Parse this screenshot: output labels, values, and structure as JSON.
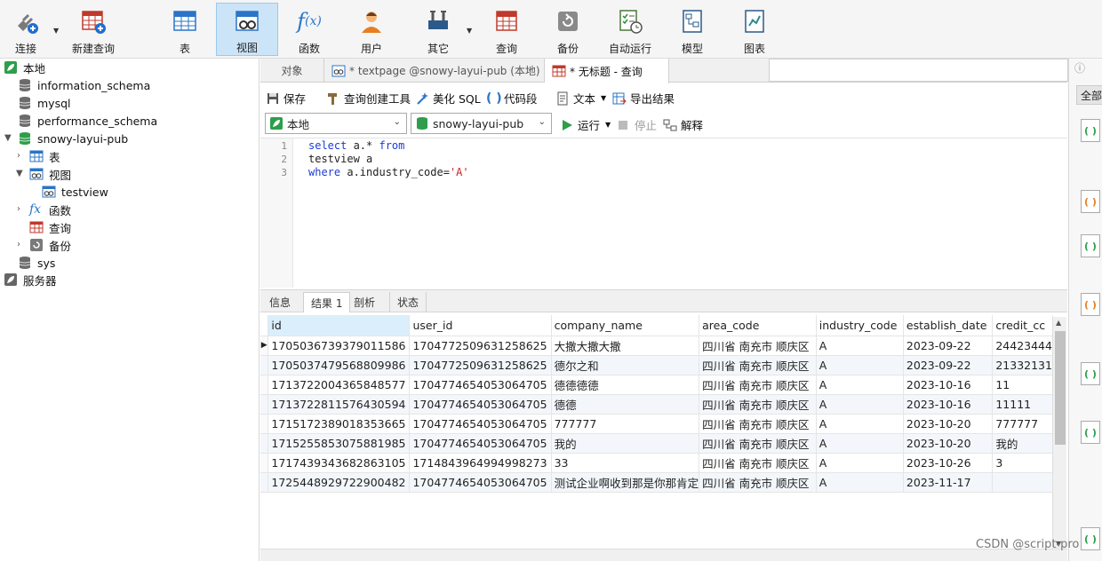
{
  "toolbar": {
    "connect": "连接",
    "new_query": "新建查询",
    "table": "表",
    "view": "视图",
    "function": "函数",
    "user": "用户",
    "other": "其它",
    "query": "查询",
    "backup": "备份",
    "auto_run": "自动运行",
    "model": "模型",
    "chart": "图表"
  },
  "sidebar": {
    "items": [
      {
        "label": "本地"
      },
      {
        "label": "information_schema"
      },
      {
        "label": "mysql"
      },
      {
        "label": "performance_schema"
      },
      {
        "label": "snowy-layui-pub"
      },
      {
        "label": "表"
      },
      {
        "label": "视图"
      },
      {
        "label": "testview"
      },
      {
        "label": "函数"
      },
      {
        "label": "查询"
      },
      {
        "label": "备份"
      },
      {
        "label": "sys"
      },
      {
        "label": "服务器"
      }
    ]
  },
  "tabs": {
    "objects": "对象",
    "textpage": "* textpage @snowy-layui-pub (本地) ...",
    "untitled": "* 无标题 - 查询"
  },
  "query_toolbar": {
    "save": "保存",
    "builder": "查询创建工具",
    "beautify": "美化 SQL",
    "snippet": "代码段",
    "text": "文本",
    "export": "导出结果"
  },
  "run_bar": {
    "connection": "本地",
    "database": "snowy-layui-pub",
    "run": "运行",
    "stop": "停止",
    "explain": "解释"
  },
  "editor": {
    "lines": [
      {
        "n": "1",
        "a": "select",
        "b": " a.* ",
        "c": "from",
        "d": "",
        "e": ""
      },
      {
        "n": "2",
        "a": "",
        "b": "testview a",
        "c": "",
        "d": "",
        "e": ""
      },
      {
        "n": "3",
        "a": "where",
        "b": " a.industry_code=",
        "c": "",
        "d": "'A'",
        "e": ""
      }
    ]
  },
  "result_tabs": {
    "info": "信息",
    "result1": "结果 1",
    "profile": "剖析",
    "status": "状态"
  },
  "grid": {
    "columns": [
      "id",
      "user_id",
      "company_name",
      "area_code",
      "industry_code",
      "establish_date",
      "credit_cc"
    ],
    "rows": [
      [
        "1705036739379011586",
        "1704772509631258625",
        "大撒大撒大撒",
        "四川省 南充市 顺庆区",
        "A",
        "2023-09-22",
        "24423444"
      ],
      [
        "1705037479568809986",
        "1704772509631258625",
        "德尔之和",
        "四川省 南充市 顺庆区",
        "A",
        "2023-09-22",
        "21332131"
      ],
      [
        "1713722004365848577",
        "1704774654053064705",
        "德德德德",
        "四川省 南充市 顺庆区",
        "A",
        "2023-10-16",
        "11"
      ],
      [
        "1713722811576430594",
        "1704774654053064705",
        "德德",
        "四川省 南充市 顺庆区",
        "A",
        "2023-10-16",
        "11111"
      ],
      [
        "1715172389018353665",
        "1704774654053064705",
        "777777",
        "四川省 南充市 顺庆区",
        "A",
        "2023-10-20",
        "777777"
      ],
      [
        "1715255853075881985",
        "1704774654053064705",
        "我的",
        "四川省 南充市 顺庆区",
        "A",
        "2023-10-20",
        "我的"
      ],
      [
        "1717439343682863105",
        "1714843964994998273",
        "33",
        "四川省 南充市 顺庆区",
        "A",
        "2023-10-26",
        "3"
      ],
      [
        "1725448929722900482",
        "1704774654053064705",
        "测试企业啊收到那是你那肯定",
        "四川省 南充市 顺庆区",
        "A",
        "2023-11-17",
        ""
      ]
    ]
  },
  "right_panel": {
    "tab": "全部"
  },
  "watermark": "CSDN @script-pro"
}
